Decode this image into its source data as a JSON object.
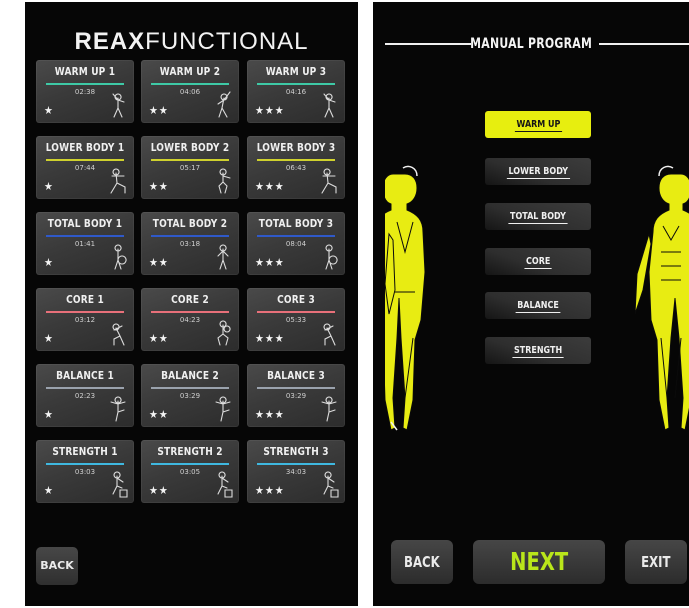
{
  "left_screen": {
    "logo": {
      "bold": "REAX",
      "normal": "FUNCTIONAL"
    },
    "back_label": "BACK",
    "tiles": [
      {
        "title": "WARM UP 1",
        "time": "02:38",
        "stars": "★",
        "color": "#3ec9a6",
        "figure": "arm-swing-figure-icon"
      },
      {
        "title": "WARM UP 2",
        "time": "04:06",
        "stars": "★★",
        "color": "#3ec9a6",
        "figure": "side-stretch-figure-icon"
      },
      {
        "title": "WARM UP 3",
        "time": "04:16",
        "stars": "★★★",
        "color": "#3ec9a6",
        "figure": "arm-swing-figure-icon"
      },
      {
        "title": "LOWER BODY 1",
        "time": "07:44",
        "stars": "★",
        "color": "#cfd12e",
        "figure": "lunge-figure-icon"
      },
      {
        "title": "LOWER BODY 2",
        "time": "05:17",
        "stars": "★★",
        "color": "#cfd12e",
        "figure": "squat-figure-icon"
      },
      {
        "title": "LOWER BODY 3",
        "time": "06:43",
        "stars": "★★★",
        "color": "#cfd12e",
        "figure": "lunge-figure-icon"
      },
      {
        "title": "TOTAL BODY 1",
        "time": "01:41",
        "stars": "★",
        "color": "#2f59c9",
        "figure": "ball-figure-icon"
      },
      {
        "title": "TOTAL BODY 2",
        "time": "03:18",
        "stars": "★★",
        "color": "#2f59c9",
        "figure": "stand-figure-icon"
      },
      {
        "title": "TOTAL BODY 3",
        "time": "08:04",
        "stars": "★★★",
        "color": "#2f59c9",
        "figure": "ball-figure-icon"
      },
      {
        "title": "CORE 1",
        "time": "03:12",
        "stars": "★",
        "color": "#e8707a",
        "figure": "crunch-figure-icon"
      },
      {
        "title": "CORE 2",
        "time": "04:23",
        "stars": "★★",
        "color": "#e8707a",
        "figure": "squat-ball-figure-icon"
      },
      {
        "title": "CORE 3",
        "time": "05:33",
        "stars": "★★★",
        "color": "#e8707a",
        "figure": "crunch-figure-icon"
      },
      {
        "title": "BALANCE 1",
        "time": "02:23",
        "stars": "★",
        "color": "#9aa2ad",
        "figure": "balance-figure-icon"
      },
      {
        "title": "BALANCE 2",
        "time": "03:29",
        "stars": "★★",
        "color": "#9aa2ad",
        "figure": "balance-figure-icon"
      },
      {
        "title": "BALANCE 3",
        "time": "03:29",
        "stars": "★★★",
        "color": "#9aa2ad",
        "figure": "balance-figure-icon"
      },
      {
        "title": "STRENGTH 1",
        "time": "03:03",
        "stars": "★",
        "color": "#3fb8e0",
        "figure": "box-step-figure-icon"
      },
      {
        "title": "STRENGTH 2",
        "time": "03:05",
        "stars": "★★",
        "color": "#3fb8e0",
        "figure": "box-step-figure-icon"
      },
      {
        "title": "STRENGTH 3",
        "time": "34:03",
        "stars": "★★★",
        "color": "#3fb8e0",
        "figure": "box-step-figure-icon"
      }
    ]
  },
  "right_screen": {
    "title": "MANUAL PROGRAM",
    "programs": [
      {
        "label": "WARM UP",
        "active": true
      },
      {
        "label": "LOWER BODY",
        "active": false
      },
      {
        "label": "TOTAL BODY",
        "active": false
      },
      {
        "label": "CORE",
        "active": false
      },
      {
        "label": "BALANCE",
        "active": false
      },
      {
        "label": "STRENGTH",
        "active": false
      }
    ],
    "back_label": "BACK",
    "next_label": "NEXT",
    "exit_label": "EXIT",
    "accent_color": "#e7ee0f",
    "next_color": "#b9e61a"
  }
}
